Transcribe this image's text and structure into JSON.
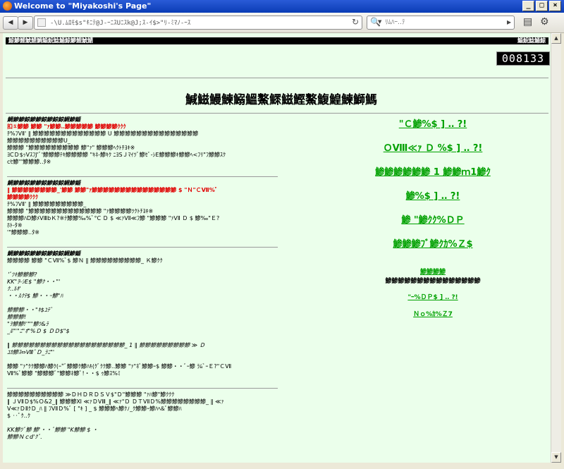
{
  "window": {
    "title": "Welcome to \"Miyakoshi's Page\""
  },
  "toolbar": {
    "back_label": "◀",
    "forward_label": "▶",
    "url": "-\\U.ﾑﾛﾓ$s\"ｷﾆﾃ@J‐ｰﾆｽUﾆｽk@J;ｽ-ｲ$>\"ﾘ-ﾐﾏﾉ‐ｰｽ",
    "search_placeholder": "ﾘﾑﾊｰ‥ﾃ",
    "reload_glyph": "↻",
    "search_glyph": "🔍",
    "search_go_glyph": "▸"
  },
  "banner": {
    "left": "鯨鯵鯉鯱鯖鯛鯔鯢鯰鯒鯨鯵鯉鯱鯖",
    "right": "鯔鯢鯰鯒鯨"
  },
  "counter": "008133",
  "heading": "鰔鰦鰻鰊鰯鰮鰲鰥鰦鰹鰲鰒鰉鰊鰤鰢",
  "left_column": [
    {
      "text": "鯛鯵鯵鯨鯵鯵鯨鯵鯨鯨鯛鯵鯔",
      "style": "b i"
    },
    {
      "text": "扣①鯵鯵 鯵鯵 \"ｧ鯵鯵‥鯵鯵鯵鯵鯵 鯵鯵鯵鯵ｸｸｸ",
      "style": "red"
    },
    {
      "text": "ﾁ%ﾌVⅡ' ‖ 鯵鯵鯵鯵鯵鯵鯵鯵鯵鯵鯵鯵鯵 U 鯵鯵鯵鯵鯵鯵鯵鯵鯵鯵鯵鯵鯵鯵鯵",
      "style": ""
    },
    {
      "text": "鯵鯵鯵鯵鯵鯵鯵鯵鯵鯵U_",
      "style": ""
    },
    {
      "text": "鯵鯵鯵 \"鯵鯵鯵鯵鯵鯵鯵鯵鯵 鯵\"ｧ\" 鯵鯵鯵ﾍｸﾄﾁﾖｷ※",
      "style": ""
    },
    {
      "text": "ﾖCＤ$ｯVｽﾌJ'ﾞ'鯵鯵鯵ﾃｷ鯵鯵鯵鯵 \"ｷﾈ‐鯵ｷｸ ﾆﾖSＪﾏｲﾂﾞ鯵ｾﾞ-ｼE鯵鯵鯵ｷ鯵鯵ﾍ<ﾌﾘ\"ﾌ鯵鯵ｽｸ",
      "style": ""
    },
    {
      "text": "cｾ鯵'\"鯵鯵鯵‥ﾀ※",
      "style": ""
    },
    {
      "gap": true
    },
    {
      "text": "鯛鯵鯵鯨鯵鯵鯨鯵鯨鯨鯛鯵鯔",
      "style": "b i",
      "sep_before": true
    },
    {
      "text": "‖ 鯵鯵鯵鯵鯵鯵鯵鯵_'鯵鯵 鯵鯵\"ｧ鯵鯵鯵鯵鯵鯵鯵鯵鯵鯵鯵鯵鯵鯵鯵 $ \"Ｎ\"ＣⅦ%ﾞ",
      "style": "red"
    },
    {
      "text": "鯵鯵鯵鯵ｸｸｸ",
      "style": "red"
    },
    {
      "text": "ﾁ%ﾌVⅡ' ‖ 鯵鯵鯵鯵鯵鯵鯵鯵鯵_",
      "style": ""
    },
    {
      "text": "鯵鯵鯵 \"鯵鯵鯵鯵鯵鯵鯵鯵鯵鯵鯵鯵鯵 \"ｧ鯵鯵鯵鯵ﾂｸﾄﾁﾖｷ※",
      "style": ""
    },
    {
      "text": "鯵鯵鯵ﾊD鯵ﾒVⅢbＫ?※ﾃ鯵鯵‰%ﾞ°C Ｄ $ ≪ｧVⅡ≪ﾌ鯵 \"鯵鯵鯵 \"ｧVⅡ Ｄ $ 鯵‰\"Ｅ?",
      "style": ""
    },
    {
      "text": "ﾎﾄ‐ﾀ※",
      "style": ""
    },
    {
      "text": "'\"鯵鯵鯵‥ﾀ※",
      "style": ""
    },
    {
      "gap": true
    },
    {
      "text": "鯛鯵鯵鯨鯵鯵鯨鯵鯨鯨鯛鯵鯔",
      "style": "b i",
      "sep_before": true
    },
    {
      "text": "鯵鯵鯵鯵 鯵鯵 \"ＣⅦ%ﾞ$ 鯵Ｎ ‖ 鯵鯵鯵鯵鯵鯵鯵鯵鯵_ Ｋ鯵ｸｸ",
      "style": ""
    },
    {
      "gap": true
    },
    {
      "text": "'ﾞﾂｷ鯵鯵鯵?",
      "style": "i"
    },
    {
      "text": "KK\"ｦ-ｼE$ \"鯵ｸ・・\"'",
      "style": "i"
    },
    {
      "text": "ｸ‥ﾙｷ'",
      "style": "i"
    },
    {
      "text": "・・ﾙｸﾃ$ 鯵・・ｰ鯵\"ﾊ",
      "style": "i"
    },
    {
      "gap": true
    },
    {
      "text": "鯵鯵鯵・・\"ｷ$ﾕﾃﾞ",
      "style": "i"
    },
    {
      "text": "鯵鯵鯵!",
      "style": "i"
    },
    {
      "text": "\"ｦ鯵鯵!'\"\"鯵ﾂ&ﾗ",
      "style": "i"
    },
    {
      "text": "_ﾙ\"'\"ﾆ\"ｵ\"%Ｄ $ ＤＤ$\"$",
      "style": "i"
    },
    {
      "gap": true
    },
    {
      "text": "‖ 鯵鯵鯵鯵鯵鯵鯵鯵鯵鯵鯵鯵鯵鯵鯵鯵鯵鯵鯵鯵_ 1 ‖ 鯵鯵鯵鯵鯵鯵鯵鯵鯵 ≫ Ｄ",
      "style": "i"
    },
    {
      "text": "ﾕｶ鯵ｽ⇔ⅧﾟＤ_ﾗﾆ\"'",
      "style": "i"
    },
    {
      "gap": true
    },
    {
      "text": "鯵鯵 \"ｧ\"ｸｸ鯵鯵ﾊ鯵ｸ(ｰ\"ﾞ鯵鯵ｸ鯵ﾊｷ(ｸﾞｸｸ鯵‥鯵鯵 \"ｧ\"ﾈﾞ鯵鯵ｰ$ 鯵鯵・・ﾞｰ鯵 ﾗﾑﾞｰＥ?\"ＣⅦ",
      "style": ""
    },
    {
      "text": "Ⅶ%ﾞ鯵鯵 \"鯵鯵鯵ﾞ\"鯵鯵ﾈ鯵ﾞ!・・$ ｩ鯵ｽ%ﾐ",
      "style": ""
    },
    {
      "gap": true
    },
    {
      "text": "鯵鯵鯵鯵鯵鯵鯵鯵鯵鯵 ≫ＤＨＤＲＤＳＶ$\"Ｄ\"鯵鯵鯵 \"ｧﾊ鯵\"鯵ｸｸｸ",
      "style": "",
      "sep_before": true
    },
    {
      "text": "‖ ＪVⅡＤ$%Ｏ&2_‖ 鯵鯵鯵Ⅺ ≪ｧＤVⅢ_‖ ≪ｧ\"Ｄ ＤＴVⅡＤ%鯵鯵鯵鯵鯵鯵鯵鯵_ ‖ ≪ｧ",
      "style": ""
    },
    {
      "text": "V≪ｧＤⅡｸＤ_ﾊ ‖ ﾌVⅡＤ%ﾞ [ \"ｷ ] _ $ 鯵鯵鯵ﾍ鯵ｸﾉ_ｸ鯵鯵ｰ鯵ﾊﾍ&ﾞ鯵鯵ﾊ",
      "style": ""
    },
    {
      "text": "$ ‥ﾟｸ‥ｸ",
      "style": ""
    },
    {
      "gap": true
    },
    {
      "text": "KK鯵ﾂﾞ鯵 鯵'・・ﾞ鯵鯵 \"K鯵鯵 $ ・",
      "style": "i"
    },
    {
      "text": "鯵鯵Ｎｃd'ｸﾞ.",
      "style": "i"
    }
  ],
  "right_column": {
    "big_links": [
      "\"Ｃ鯵%$ ] ‥ ?!",
      "ＯⅧ≪ｧ Ｄ %$ ] ‥ ?!",
      "鯵鯵鯵鯵鯵鯵 1 鯵鯵ｍ1鯵ｸ",
      "鯵%$ ] ‥ ?!",
      "鯵 \"鯵ｸｸ%ＤＰ",
      "鯵鯵鯵ﾌﾞ鯵ｸｶ%Ｚ$"
    ],
    "green_title": "鯵鯵鯵鯵",
    "black_line": "鯵鯵鯵鯵鯵鯵鯵鯵鯵鯵鯵鯵鯵鯵鯵",
    "small_links": [
      "\"ｰ%ＤＰ$ ] ‥ ?!",
      "Ｎｏ%ｶ%Ｚ7"
    ]
  }
}
